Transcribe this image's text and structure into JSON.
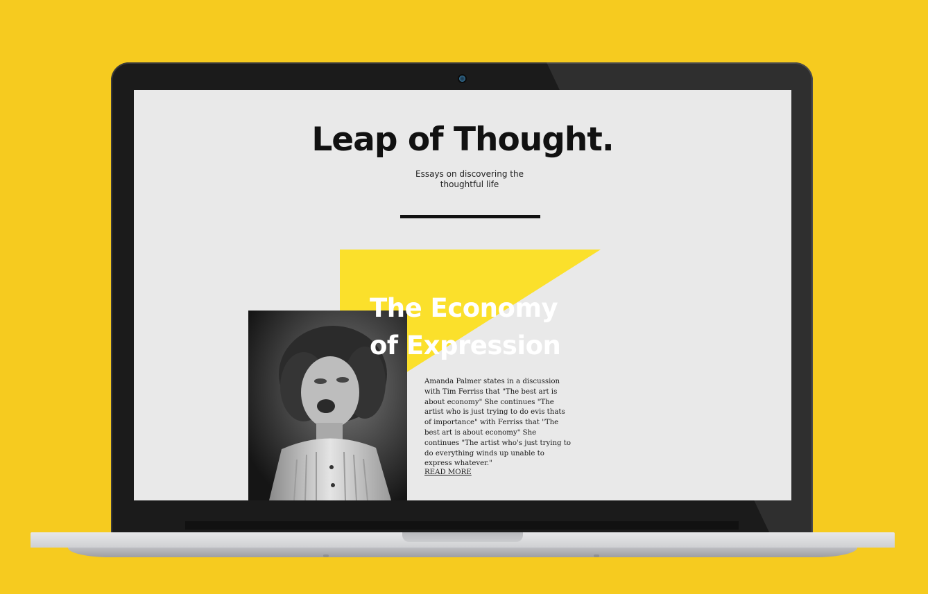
{
  "site": {
    "title": "Leap of Thought.",
    "tagline": "Essays on discovering the thoughtful life"
  },
  "article": {
    "title_line1": "The Economy",
    "title_line2": "of Expression",
    "excerpt": "Amanda Palmer states in a discussion with Tim Ferriss that \"The best art is about economy\" She continues \"The artist who is just trying to do evis thats of importance\" with Ferriss that \"The best art is about economy\" She continues \"The artist who's just trying to do everything winds up unable to express whatever.\"",
    "read_more": "READ MORE",
    "image_alt": "black-and-white photo of a child making a face"
  },
  "colors": {
    "background": "#f6cb1f",
    "screen": "#e9e9e9",
    "accent_yellow": "#fbe02b",
    "text": "#111111"
  }
}
